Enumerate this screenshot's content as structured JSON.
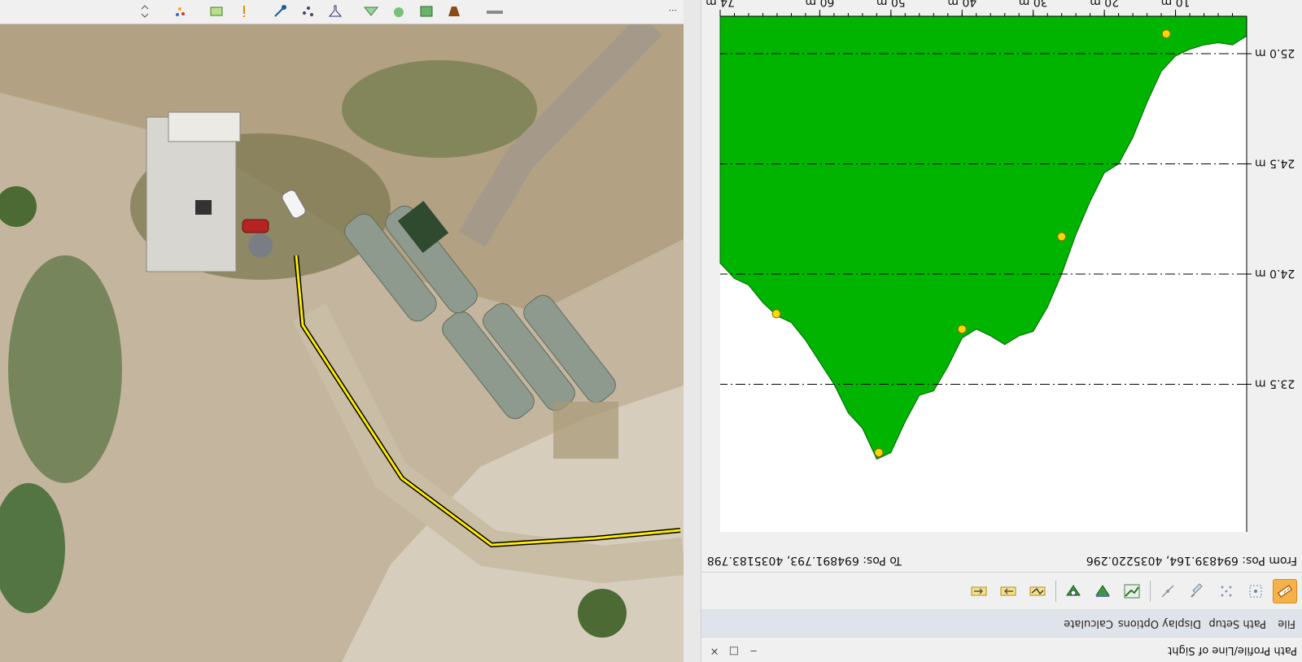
{
  "panel": {
    "title": "Path Profile/Line of Sight",
    "window_buttons": {
      "minimize": "‒",
      "restore": "□",
      "close": "×"
    }
  },
  "menu": [
    "File",
    "Path Setup",
    "Display Options",
    "Calculate"
  ],
  "toolbar_icons": [
    "measure-ruler-icon",
    "select-area-icon",
    "point-grid-icon",
    "brush-icon",
    "line-tool-icon",
    "profile-graph-icon",
    "terrain-down-icon",
    "terrain-view-icon",
    "zigzag-profile-icon",
    "arrow-right-icon",
    "arrow-left-icon"
  ],
  "positions": {
    "from": "From Pos: 694839.164, 4035220.296",
    "to": "To Pos: 694891.793, 4035183.798"
  },
  "chart_data": {
    "type": "area",
    "xlabel": "",
    "ylabel": "",
    "x_unit": "m",
    "xlim": [
      0,
      74
    ],
    "ylim": [
      22.83,
      25.17
    ],
    "y_inverted": true,
    "x_ticks": [
      "10 m",
      "20 m",
      "30 m",
      "40 m",
      "50 m",
      "60 m",
      "74 m"
    ],
    "x_tick_values": [
      10,
      20,
      30,
      40,
      50,
      60,
      74
    ],
    "y_ticks": [
      "23.5 m",
      "24.0 m",
      "24.5 m",
      "25.0 m"
    ],
    "y_tick_values": [
      23.5,
      24.0,
      24.5,
      25.0
    ],
    "grid": "horizontal dash-dot",
    "fill_color": "#00b400",
    "marker_color": "#ffd700",
    "profile": {
      "x": [
        0,
        2,
        4,
        6,
        8,
        10,
        12,
        14,
        16,
        18,
        20,
        22,
        24,
        26,
        28,
        30,
        32,
        34,
        36,
        38,
        40,
        42,
        44,
        46,
        48,
        50,
        52,
        54,
        56,
        58,
        60,
        62,
        64,
        66,
        68,
        70,
        72,
        74
      ],
      "elevation": [
        25.08,
        25.04,
        25.05,
        25.04,
        25.02,
        24.99,
        24.92,
        24.78,
        24.62,
        24.5,
        24.46,
        24.33,
        24.18,
        24.0,
        23.85,
        23.74,
        23.72,
        23.68,
        23.72,
        23.75,
        23.71,
        23.58,
        23.47,
        23.45,
        23.33,
        23.19,
        23.16,
        23.3,
        23.37,
        23.5,
        23.6,
        23.7,
        23.78,
        23.81,
        23.87,
        23.95,
        23.98,
        24.05
      ]
    },
    "markers": {
      "x": [
        11.3,
        26.0,
        40.0,
        51.7,
        66.1
      ],
      "elevation": [
        25.09,
        24.17,
        23.75,
        23.19,
        23.82
      ]
    }
  },
  "map": {
    "status_text": "..."
  }
}
